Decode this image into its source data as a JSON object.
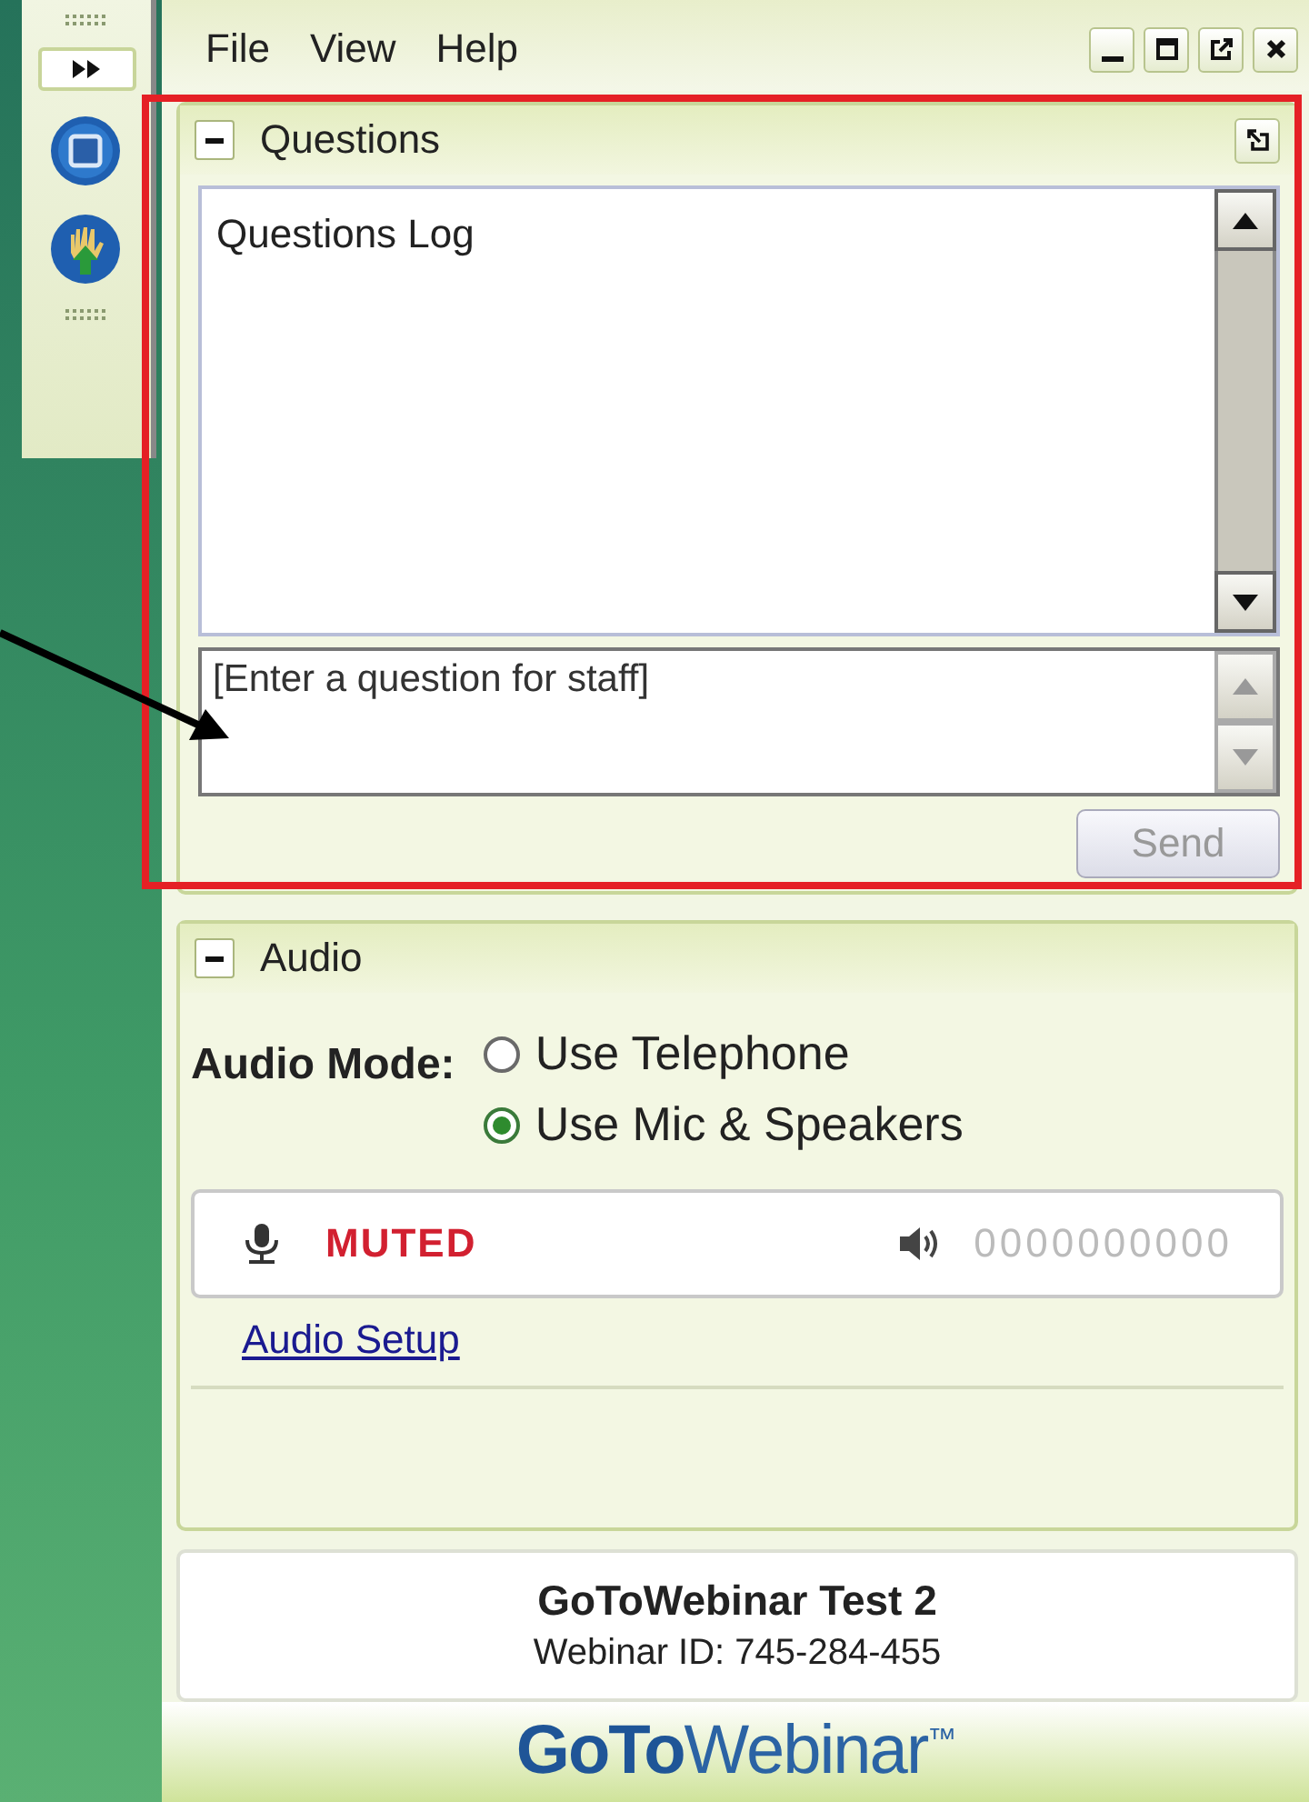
{
  "menu": [
    {
      "label": "File"
    },
    {
      "label": "View"
    },
    {
      "label": "Help"
    }
  ],
  "questions": {
    "title": "Questions",
    "expanded": true,
    "log_title": "Questions Log",
    "input": {
      "placeholder": "[Enter a question for staff]"
    },
    "send": {
      "label": "Send",
      "disabled": true
    }
  },
  "audio": {
    "title": "Audio",
    "expanded": true,
    "mode_label": "Audio Mode:",
    "options": [
      {
        "label": "Use Telephone",
        "selected": false
      },
      {
        "label": "Use Mic & Speakers",
        "selected": true
      }
    ],
    "mic": {
      "status": "MUTED",
      "muted": true
    },
    "speaker_level": "0000000000",
    "setup_link": "Audio Setup"
  },
  "session": {
    "title": "GoToWebinar Test 2",
    "webinar_id": "Webinar ID: 745-284-455"
  },
  "logo": "**GoTo**Webinar$^{™}$"
}
